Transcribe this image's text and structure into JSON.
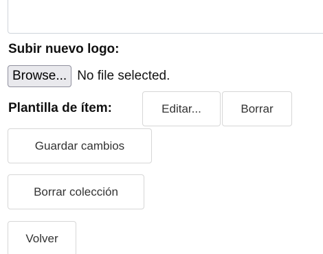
{
  "logo": {
    "label": "Subir nuevo logo:",
    "browse_label": "Browse...",
    "file_status": "No file selected."
  },
  "item_template": {
    "label": "Plantilla de ítem:",
    "edit_label": "Editar...",
    "delete_label": "Borrar"
  },
  "actions": {
    "save_label": "Guardar cambios",
    "delete_collection_label": "Borrar colección",
    "back_label": "Volver"
  }
}
